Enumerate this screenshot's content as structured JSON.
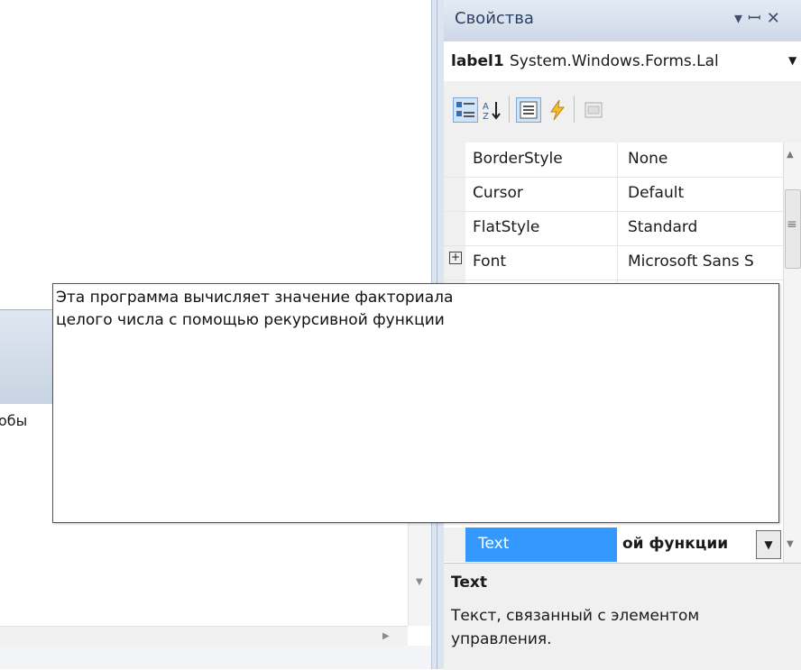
{
  "left": {
    "fragment": "обы"
  },
  "panel": {
    "title": "Свойства",
    "title_buttons": "▾ ꟷ ✕"
  },
  "object": {
    "name": "label1",
    "type": "System.Windows.Forms.Lal"
  },
  "properties": [
    {
      "name": "BorderStyle",
      "value": "None"
    },
    {
      "name": "Cursor",
      "value": "Default"
    },
    {
      "name": "FlatStyle",
      "value": "Standard"
    },
    {
      "name": "Font",
      "value": "Microsoft Sans S",
      "expandable": true
    }
  ],
  "selected_property": {
    "name": "Text",
    "value": "ой функции"
  },
  "editor": {
    "lines": "Эта программа вычисляет значение факториала\nцелого числа с помощью рекурсивной функции"
  },
  "description": {
    "title": "Text",
    "text": "Текст, связанный с элементом управления."
  },
  "colors": {
    "selection": "#3399ff",
    "panel_bg": "#f0f0f0",
    "title_text": "#2a3f63"
  }
}
